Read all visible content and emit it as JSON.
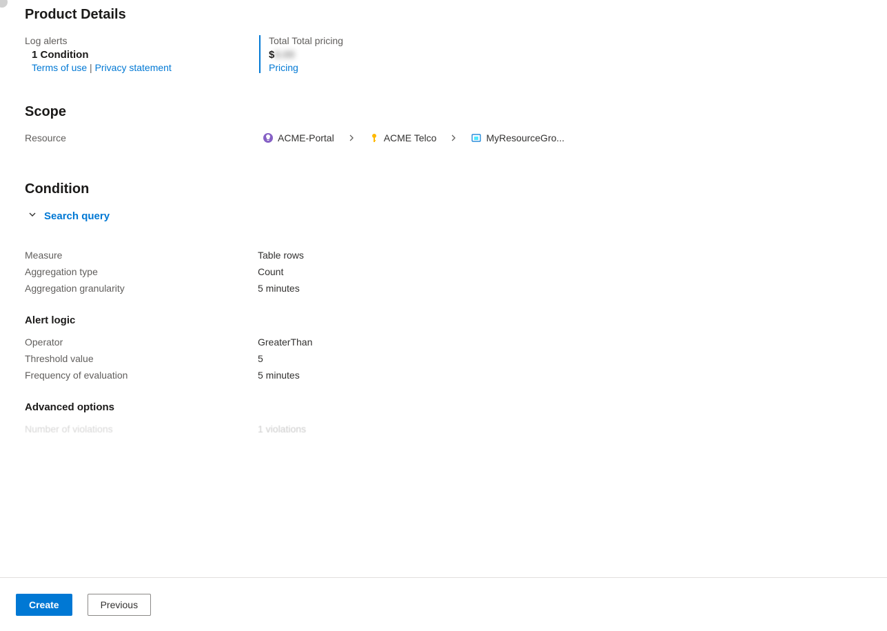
{
  "productDetails": {
    "title": "Product Details",
    "logAlerts": {
      "label": "Log alerts",
      "conditionCount": "1 Condition",
      "termsLink": "Terms of use",
      "separator": " | ",
      "privacyLink": "Privacy statement"
    },
    "pricing": {
      "label": "Total Total pricing",
      "priceSymbol": "$",
      "priceBlurred": "0.00",
      "pricingLink": "Pricing"
    }
  },
  "scope": {
    "title": "Scope",
    "label": "Resource",
    "crumbs": [
      "ACME-Portal",
      "ACME Telco",
      "MyResourceGro..."
    ]
  },
  "condition": {
    "title": "Condition",
    "searchQuery": "Search query",
    "measure": {
      "label": "Measure",
      "value": "Table rows"
    },
    "aggType": {
      "label": "Aggregation type",
      "value": "Count"
    },
    "aggGran": {
      "label": "Aggregation granularity",
      "value": "5 minutes"
    },
    "alertLogicTitle": "Alert logic",
    "operator": {
      "label": "Operator",
      "value": "GreaterThan"
    },
    "threshold": {
      "label": "Threshold value",
      "value": "5"
    },
    "frequency": {
      "label": "Frequency of evaluation",
      "value": "5 minutes"
    },
    "advancedTitle": "Advanced options",
    "violations": {
      "label": "Number of violations",
      "value": "1 violations"
    }
  },
  "footer": {
    "create": "Create",
    "previous": "Previous"
  }
}
